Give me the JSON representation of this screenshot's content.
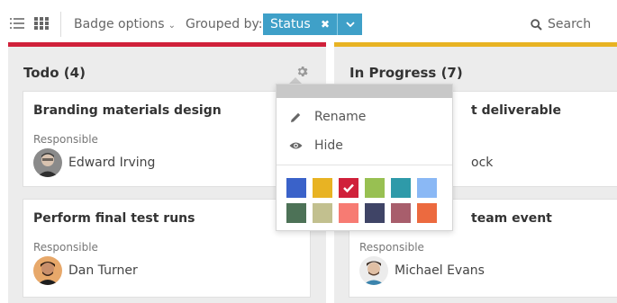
{
  "toolbar": {
    "badge_options_label": "Badge options",
    "grouped_by_label": "Grouped by:",
    "grouped_value": "Status",
    "search_label": "Search"
  },
  "columns": [
    {
      "title": "Todo (4)",
      "color": "#d0213a",
      "cards": [
        {
          "title": "Branding materials design",
          "responsible_label": "Responsible",
          "person": "Edward Irving"
        },
        {
          "title": "Perform final test runs",
          "responsible_label": "Responsible",
          "person": "Dan Turner"
        }
      ]
    },
    {
      "title": "In Progress (7)",
      "color": "#e8b323",
      "cards": [
        {
          "title_visible": "t deliverable",
          "responsible_label": "",
          "person_visible": "ock"
        },
        {
          "title_visible": "team event",
          "responsible_label": "Responsible",
          "person": "Michael Evans"
        }
      ]
    }
  ],
  "popup": {
    "menu": [
      {
        "label": "Rename",
        "icon": "pencil-icon"
      },
      {
        "label": "Hide",
        "icon": "eye-icon"
      }
    ],
    "swatches": [
      {
        "color": "#3a62c9",
        "selected": false
      },
      {
        "color": "#e8b323",
        "selected": false
      },
      {
        "color": "#d0213a",
        "selected": true
      },
      {
        "color": "#98c052",
        "selected": false
      },
      {
        "color": "#2e9aa9",
        "selected": false
      },
      {
        "color": "#8ab8f5",
        "selected": false
      },
      {
        "color": "#4d7257",
        "selected": false
      },
      {
        "color": "#c2c08f",
        "selected": false
      },
      {
        "color": "#f77b73",
        "selected": false
      },
      {
        "color": "#3f4466",
        "selected": false
      },
      {
        "color": "#a85e6c",
        "selected": false
      },
      {
        "color": "#ec6a3f",
        "selected": false
      }
    ]
  }
}
